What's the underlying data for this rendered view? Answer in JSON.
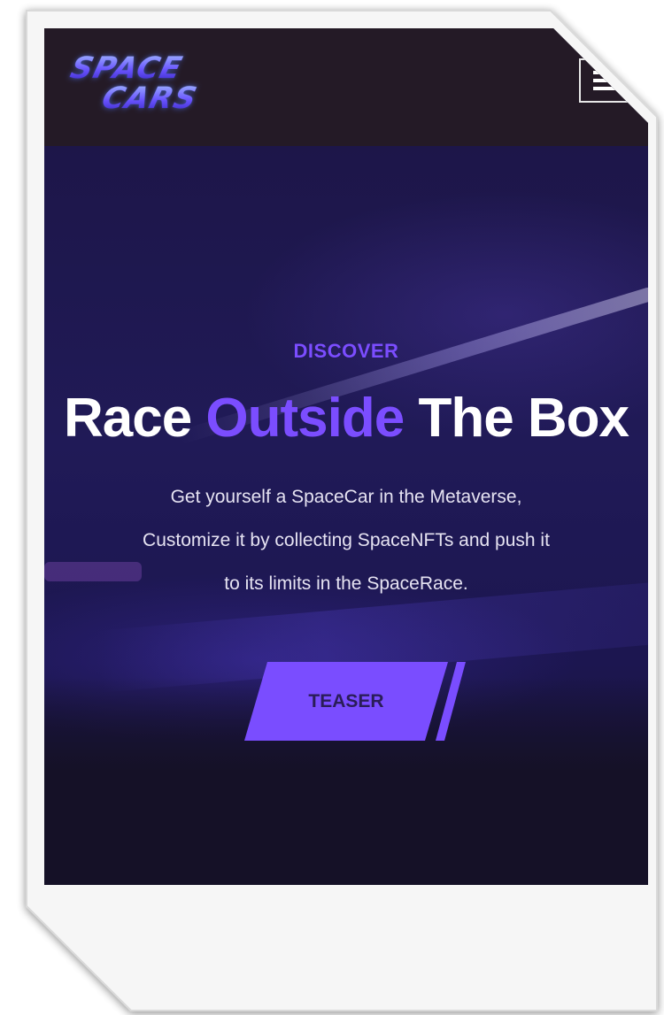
{
  "colors": {
    "accent": "#7b4dff",
    "header_bg": "#241a26",
    "hero_bg": "#1d1649",
    "text_light": "#ffffff",
    "button_text": "#2a1d58"
  },
  "header": {
    "logo_line1": "SPACE",
    "logo_line2": "CARS",
    "menu_icon": "hamburger-menu-icon"
  },
  "hero": {
    "eyebrow": "DISCOVER",
    "headline_part1": "Race ",
    "headline_accent": "Outside",
    "headline_part2": " The Box",
    "subtext_line1": "Get yourself a SpaceCar in the Metaverse,",
    "subtext_line2": "Customize it by collecting SpaceNFTs and push it",
    "subtext_line3": "to its limits in the SpaceRace.",
    "cta_label": "TEASER"
  }
}
